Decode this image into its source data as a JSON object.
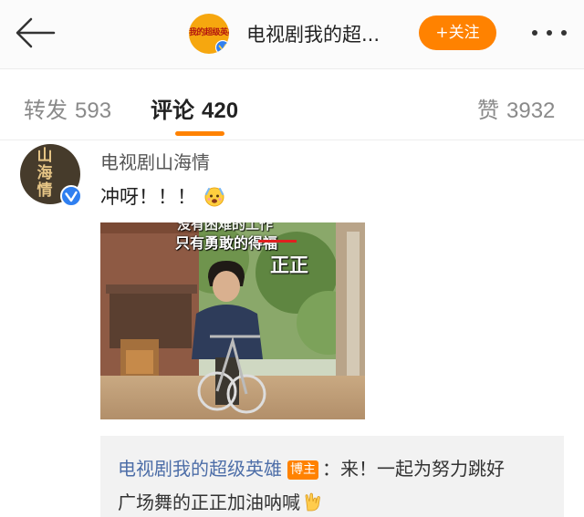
{
  "header": {
    "account_name": "电视剧我的超...",
    "avatar_logo_text": "我的超级英雄",
    "follow_label": "+关注"
  },
  "tabs": [
    {
      "label": "转发",
      "count": "593"
    },
    {
      "label": "评论",
      "count": "420"
    },
    {
      "label": "赞",
      "count": "3932"
    }
  ],
  "comment": {
    "author": "电视剧山海情",
    "avatar_text": "山海情",
    "text": "冲呀！！！",
    "image": {
      "caption_top": "没有困难的工作",
      "caption_main": "只有勇敢的",
      "caption_struck": "得福",
      "overlay_name": "正正"
    },
    "reply": {
      "author": "电视剧我的超级英雄",
      "badge": "博主",
      "text_line1": "：来！一起为努力跳好",
      "text_line2": "广场舞的正正加油呐喊"
    }
  },
  "colors": {
    "accent": "#ff8200",
    "reply_name": "#4d6ea8",
    "verified": "#2f7ff0"
  }
}
